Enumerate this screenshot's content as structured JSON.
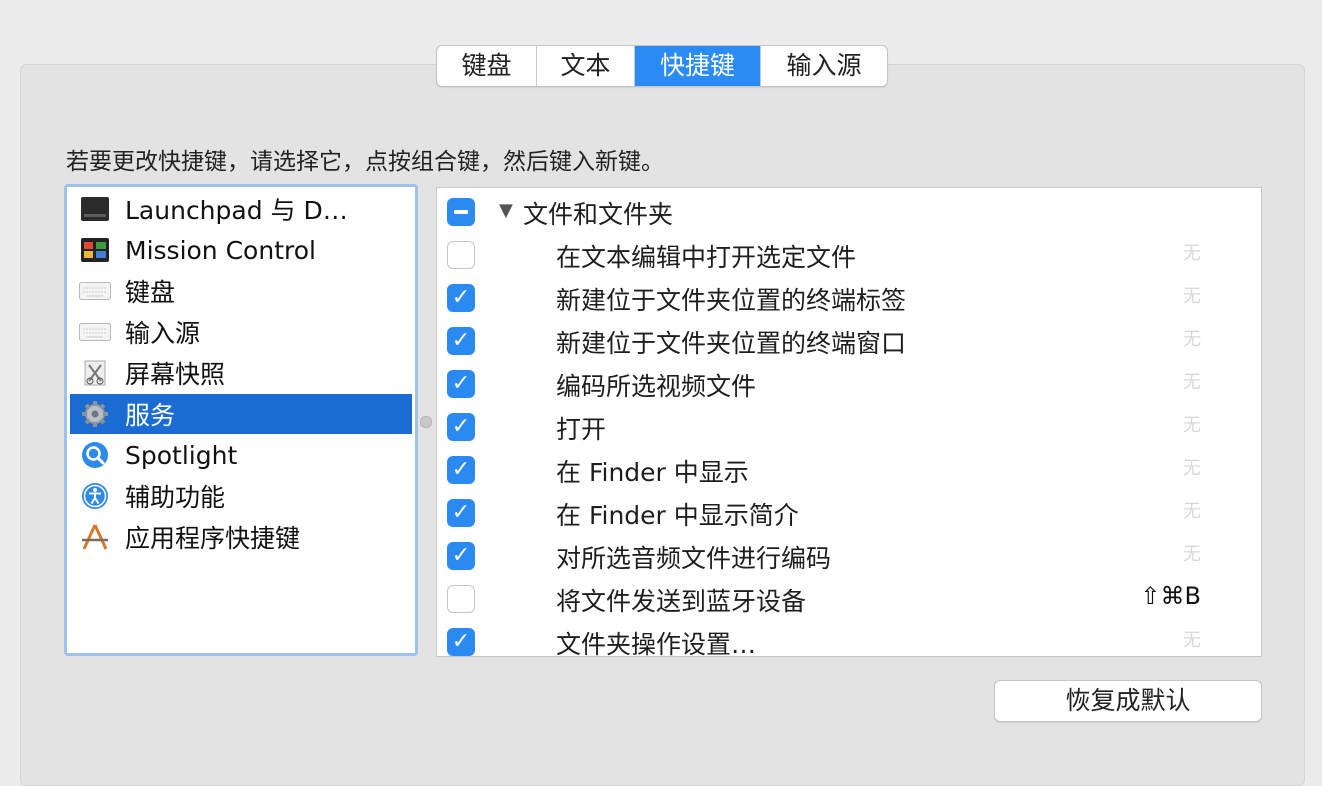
{
  "tabs": [
    {
      "label": "键盘",
      "active": false
    },
    {
      "label": "文本",
      "active": false
    },
    {
      "label": "快捷键",
      "active": true
    },
    {
      "label": "输入源",
      "active": false
    }
  ],
  "instruction": "若要更改快捷键，请选择它，点按组合键，然后键入新键。",
  "categories": [
    {
      "label": "Launchpad 与 D…",
      "icon": "launchpad-icon"
    },
    {
      "label": "Mission Control",
      "icon": "mission-control-icon"
    },
    {
      "label": "键盘",
      "icon": "keyboard-icon"
    },
    {
      "label": "输入源",
      "icon": "keyboard-icon"
    },
    {
      "label": "屏幕快照",
      "icon": "screenshot-icon"
    },
    {
      "label": "服务",
      "icon": "gear-icon",
      "selected": true
    },
    {
      "label": "Spotlight",
      "icon": "spotlight-icon"
    },
    {
      "label": "辅助功能",
      "icon": "accessibility-icon"
    },
    {
      "label": "应用程序快捷键",
      "icon": "app-shortcuts-icon"
    }
  ],
  "group": {
    "label": "文件和文件夹",
    "state": "mixed",
    "expanded": true
  },
  "services": [
    {
      "label": "在文本编辑中打开选定文件",
      "checked": false,
      "shortcut": "无"
    },
    {
      "label": "新建位于文件夹位置的终端标签",
      "checked": true,
      "shortcut": "无"
    },
    {
      "label": "新建位于文件夹位置的终端窗口",
      "checked": true,
      "shortcut": "无"
    },
    {
      "label": "编码所选视频文件",
      "checked": true,
      "shortcut": "无"
    },
    {
      "label": "打开",
      "checked": true,
      "shortcut": "无"
    },
    {
      "label": "在 Finder 中显示",
      "checked": true,
      "shortcut": "无"
    },
    {
      "label": "在 Finder 中显示简介",
      "checked": true,
      "shortcut": "无"
    },
    {
      "label": "对所选音频文件进行编码",
      "checked": true,
      "shortcut": "无"
    },
    {
      "label": "将文件发送到蓝牙设备",
      "checked": false,
      "shortcut": "⇧⌘B"
    },
    {
      "label": "文件夹操作设置…",
      "checked": true,
      "shortcut": "无"
    }
  ],
  "restore_button": "恢复成默认",
  "colors": {
    "accent": "#2a8af2",
    "selection": "#1a6bd2"
  }
}
